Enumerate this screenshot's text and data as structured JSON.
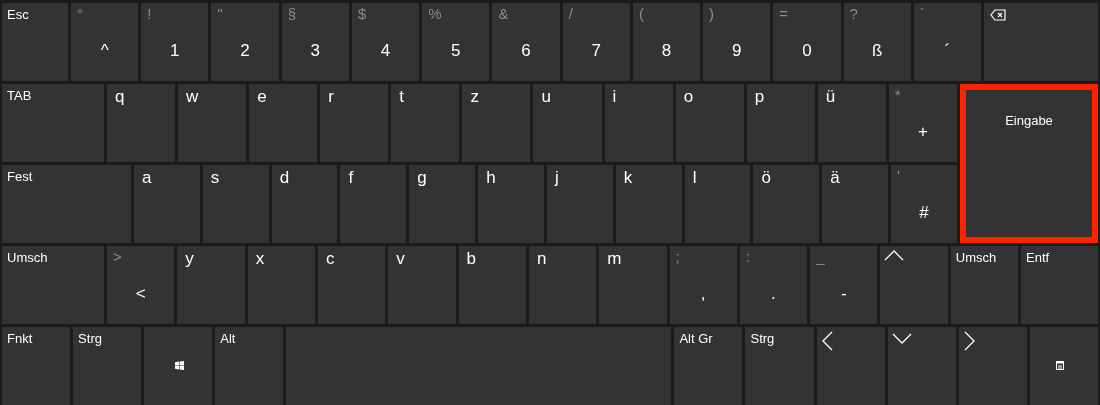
{
  "rows": [
    [
      {
        "kind": "func",
        "label": "Esc"
      },
      {
        "kind": "dual",
        "shift": "°",
        "label": "^"
      },
      {
        "kind": "dual",
        "shift": "!",
        "label": "1"
      },
      {
        "kind": "dual",
        "shift": "\"",
        "label": "2"
      },
      {
        "kind": "dual",
        "shift": "§",
        "label": "3"
      },
      {
        "kind": "dual",
        "shift": "$",
        "label": "4"
      },
      {
        "kind": "dual",
        "shift": "%",
        "label": "5"
      },
      {
        "kind": "dual",
        "shift": "&",
        "label": "6"
      },
      {
        "kind": "dual",
        "shift": "/",
        "label": "7"
      },
      {
        "kind": "dual",
        "shift": "(",
        "label": "8"
      },
      {
        "kind": "dual",
        "shift": ")",
        "label": "9"
      },
      {
        "kind": "dual",
        "shift": "=",
        "label": "0"
      },
      {
        "kind": "dual",
        "shift": "?",
        "label": "ß"
      },
      {
        "kind": "dual",
        "shift": "`",
        "label": "´"
      },
      {
        "kind": "backspace"
      }
    ],
    [
      {
        "kind": "func",
        "label": "TAB"
      },
      {
        "kind": "char",
        "label": "q"
      },
      {
        "kind": "char",
        "label": "w"
      },
      {
        "kind": "char",
        "label": "e"
      },
      {
        "kind": "char",
        "label": "r"
      },
      {
        "kind": "char",
        "label": "t"
      },
      {
        "kind": "char",
        "label": "z"
      },
      {
        "kind": "char",
        "label": "u"
      },
      {
        "kind": "char",
        "label": "i"
      },
      {
        "kind": "char",
        "label": "o"
      },
      {
        "kind": "char",
        "label": "p"
      },
      {
        "kind": "char",
        "label": "ü"
      },
      {
        "kind": "dual",
        "shift": "*",
        "label": "+"
      }
    ],
    [
      {
        "kind": "func",
        "label": "Fest"
      },
      {
        "kind": "char",
        "label": "a"
      },
      {
        "kind": "char",
        "label": "s"
      },
      {
        "kind": "char",
        "label": "d"
      },
      {
        "kind": "char",
        "label": "f"
      },
      {
        "kind": "char",
        "label": "g"
      },
      {
        "kind": "char",
        "label": "h"
      },
      {
        "kind": "char",
        "label": "j"
      },
      {
        "kind": "char",
        "label": "k"
      },
      {
        "kind": "char",
        "label": "l"
      },
      {
        "kind": "char",
        "label": "ö"
      },
      {
        "kind": "char",
        "label": "ä"
      },
      {
        "kind": "dual",
        "shift": "'",
        "label": "#"
      }
    ],
    [
      {
        "kind": "func",
        "label": "Umsch"
      },
      {
        "kind": "dual",
        "shift": ">",
        "label": "<"
      },
      {
        "kind": "char",
        "label": "y"
      },
      {
        "kind": "char",
        "label": "x"
      },
      {
        "kind": "char",
        "label": "c"
      },
      {
        "kind": "char",
        "label": "v"
      },
      {
        "kind": "char",
        "label": "b"
      },
      {
        "kind": "char",
        "label": "n"
      },
      {
        "kind": "char",
        "label": "m"
      },
      {
        "kind": "dual",
        "shift": ";",
        "label": ","
      },
      {
        "kind": "dual",
        "shift": ":",
        "label": "."
      },
      {
        "kind": "dual",
        "shift": "_",
        "label": "-"
      },
      {
        "kind": "up"
      },
      {
        "kind": "func",
        "label": "Umsch"
      },
      {
        "kind": "func",
        "label": "Entf"
      }
    ],
    [
      {
        "kind": "func",
        "label": "Fnkt"
      },
      {
        "kind": "func",
        "label": "Strg"
      },
      {
        "kind": "windows"
      },
      {
        "kind": "func",
        "label": "Alt"
      },
      {
        "kind": "space"
      },
      {
        "kind": "func",
        "label": "Alt Gr"
      },
      {
        "kind": "func",
        "label": "Strg"
      },
      {
        "kind": "left"
      },
      {
        "kind": "down"
      },
      {
        "kind": "right"
      },
      {
        "kind": "keyboard"
      }
    ]
  ],
  "enter_key": {
    "label": "Eingabe",
    "highlighted": true
  }
}
